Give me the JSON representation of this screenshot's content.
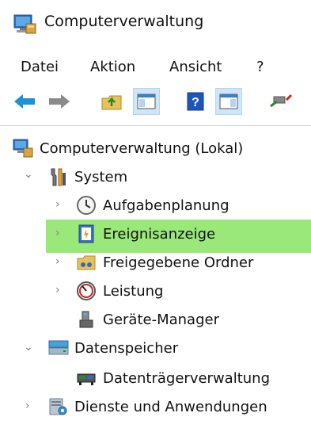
{
  "window": {
    "title": "Computerverwaltung"
  },
  "menu": {
    "items": [
      "Datei",
      "Aktion",
      "Ansicht",
      "?"
    ]
  },
  "toolbar": {
    "icons": [
      "back-arrow-icon",
      "forward-arrow-icon",
      "up-folder-icon",
      "show-hide-console-tree-icon",
      "help-icon",
      "show-hide-action-pane-icon",
      "connect-icon"
    ]
  },
  "tree": {
    "root": "Computerverwaltung (Lokal)",
    "system": "System",
    "aufgabenplanung": "Aufgabenplanung",
    "ereignisanzeige": "Ereignisanzeige",
    "freigegebene_ordner": "Freigegebene Ordner",
    "leistung": "Leistung",
    "geraete_manager": "Geräte-Manager",
    "datenspeicher": "Datenspeicher",
    "datentraegerverwaltung": "Datenträgerverwaltung",
    "dienste": "Dienste und Anwendungen"
  },
  "colors": {
    "selection_highlight": "#9ae879",
    "pressed_button": "#cfe6f9",
    "accent_blue": "#1f8fd6"
  }
}
